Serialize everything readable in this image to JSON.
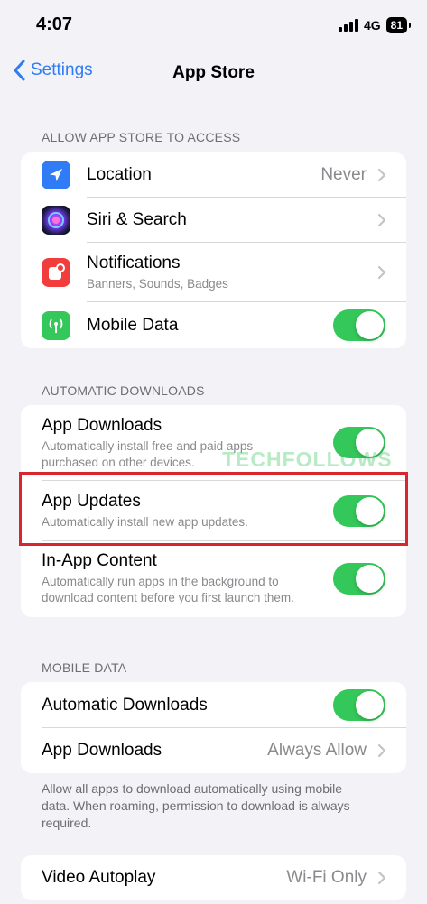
{
  "status_bar": {
    "time": "4:07",
    "network": "4G",
    "battery": "81"
  },
  "nav": {
    "back_label": "Settings",
    "title": "App Store"
  },
  "sections": {
    "access": {
      "header": "ALLOW APP STORE TO ACCESS",
      "location": {
        "title": "Location",
        "value": "Never"
      },
      "siri": {
        "title": "Siri & Search"
      },
      "notifications": {
        "title": "Notifications",
        "subtitle": "Banners, Sounds, Badges"
      },
      "mobile_data": {
        "title": "Mobile Data",
        "on": true
      }
    },
    "auto_downloads": {
      "header": "AUTOMATIC DOWNLOADS",
      "app_downloads": {
        "title": "App Downloads",
        "subtitle_1": "Automatically install free and paid apps",
        "subtitle_2": "purchased on other devices.",
        "on": true
      },
      "app_updates": {
        "title": "App Updates",
        "subtitle": "Automatically install new app updates.",
        "on": true
      },
      "in_app_content": {
        "title": "In-App Content",
        "subtitle_1": "Automatically run apps in the background to",
        "subtitle_2": "download content before you first launch them.",
        "on": true
      }
    },
    "mobile_data": {
      "header": "MOBILE DATA",
      "automatic_downloads": {
        "title": "Automatic Downloads",
        "on": true
      },
      "app_downloads": {
        "title": "App Downloads",
        "value": "Always Allow"
      },
      "footer_1": "Allow all apps to download automatically using mobile",
      "footer_2": "data. When roaming, permission to download is always",
      "footer_3": "required."
    },
    "video": {
      "video_autoplay": {
        "title": "Video Autoplay",
        "value": "Wi-Fi Only"
      }
    }
  },
  "watermark": "TECHFOLLOWS",
  "colors": {
    "accent": "#2f7cf6",
    "toggle_on": "#34c759",
    "highlight": "#d9262d"
  }
}
